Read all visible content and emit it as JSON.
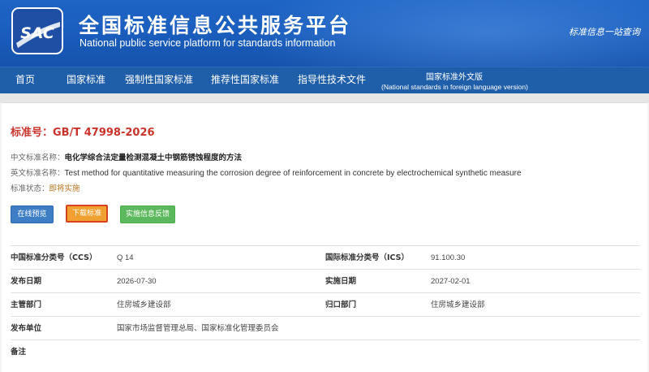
{
  "header": {
    "logo_text": "SAC",
    "title_cn": "全国标准信息公共服务平台",
    "title_en": "National public service platform  for standards information",
    "slogan": "标准信息一站查询"
  },
  "nav": {
    "items": [
      {
        "label": "首页"
      },
      {
        "label": "国家标准"
      },
      {
        "label": "强制性国家标准"
      },
      {
        "label": "推荐性国家标准"
      },
      {
        "label": "指导性技术文件"
      }
    ],
    "foreign": {
      "label_cn": "国家标准外文版",
      "label_en": "(National standards in foreign language version)"
    }
  },
  "standard": {
    "number_label": "标准号：",
    "number": "GB/T 47998-2026",
    "cn_name_label": "中文标准名称：",
    "cn_name": "电化学综合法定量检测混凝土中钢筋锈蚀程度的方法",
    "en_name_label": "英文标准名称：",
    "en_name": "Test method for quantitative measuring the corrosion degree of reinforcement in concrete by electrochemical synthetic measure",
    "status_label": "标准状态：",
    "status": "即将实施"
  },
  "buttons": {
    "preview": "在线预览",
    "download": "下载标准",
    "feedback": "实施信息反馈"
  },
  "details": {
    "ccs_label": "中国标准分类号（CCS）",
    "ccs_value": "Q 14",
    "ics_label": "国际标准分类号（ICS）",
    "ics_value": "91.100.30",
    "publish_label": "发布日期",
    "publish_value": "2026-07-30",
    "implement_label": "实施日期",
    "implement_value": "2027-02-01",
    "dept_label": "主管部门",
    "dept_value": "住房城乡建设部",
    "central_label": "归口部门",
    "central_value": "住房城乡建设部",
    "issuer_label": "发布单位",
    "issuer_value": "国家市场监督管理总局、国家标准化管理委员会",
    "remarks_label": "备注"
  },
  "colors": {
    "header_blue": "#1b5fbf",
    "nav_blue": "#1f5ea8",
    "std_red": "#c8342b",
    "status_orange": "#b8721b"
  }
}
